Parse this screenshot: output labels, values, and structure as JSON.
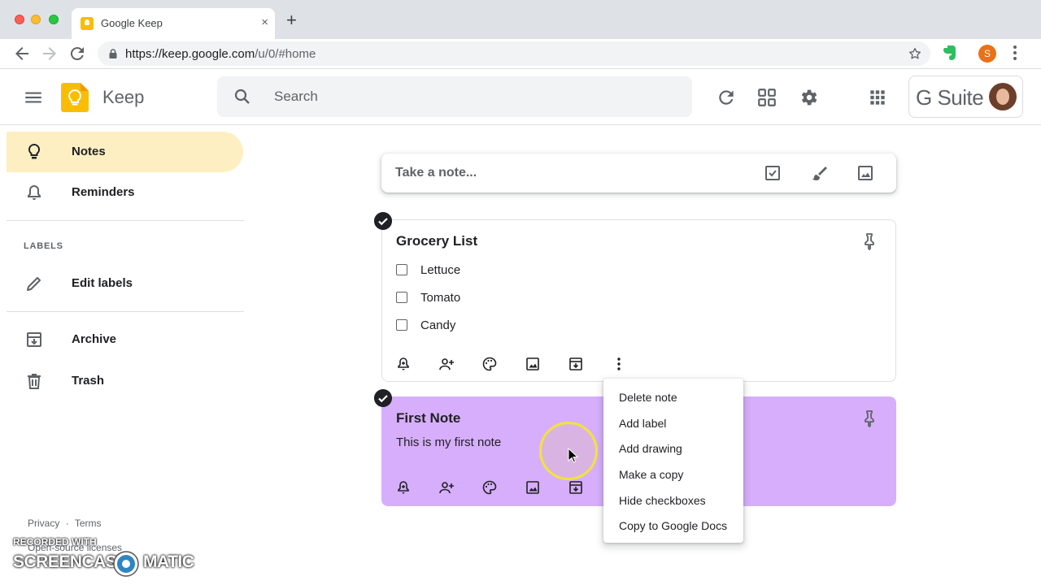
{
  "browser": {
    "tab_title": "Google Keep",
    "tab_close": "×",
    "new_tab": "+",
    "url_host": "https://keep.google.com",
    "url_path": "/u/0/#home",
    "profile_initial": "S"
  },
  "header": {
    "app_name": "Keep",
    "search_placeholder": "Search",
    "gsuite_label": "G Suite"
  },
  "sidebar": {
    "items": [
      {
        "label": "Notes",
        "icon": "lightbulb-icon",
        "active": true
      },
      {
        "label": "Reminders",
        "icon": "bell-icon"
      },
      {
        "label": "Edit labels",
        "icon": "pencil-icon"
      },
      {
        "label": "Archive",
        "icon": "archive-icon"
      },
      {
        "label": "Trash",
        "icon": "trash-icon"
      }
    ],
    "labels_heading": "LABELS",
    "footer": {
      "privacy": "Privacy",
      "separator": "·",
      "terms": "Terms",
      "oss": "Open-source licenses"
    }
  },
  "main": {
    "take_note_placeholder": "Take a note...",
    "notes": [
      {
        "title": "Grocery List",
        "items": [
          "Lettuce",
          "Tomato",
          "Candy"
        ],
        "color": "#ffffff"
      },
      {
        "title": "First Note",
        "body": "This is my first note",
        "color": "#d7aefb"
      }
    ]
  },
  "context_menu": {
    "items": [
      "Delete note",
      "Add label",
      "Add drawing",
      "Make a copy",
      "Hide checkboxes",
      "Copy to Google Docs"
    ]
  },
  "watermark": {
    "line1": "RECORDED WITH",
    "left": "SCREENCAST",
    "right": "MATIC"
  },
  "colors": {
    "accent": "#feefc3",
    "note_purple": "#d7aefb",
    "keep_yellow": "#fbbc04"
  }
}
